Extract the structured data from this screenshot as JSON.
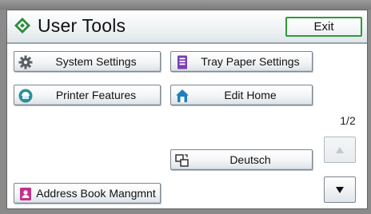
{
  "window": {
    "title": "User Tools",
    "icon": "user-tools-diamond-icon",
    "exit_label": "Exit"
  },
  "buttons": {
    "system_settings": {
      "label": "System Settings",
      "icon": "gear-icon"
    },
    "tray_paper_settings": {
      "label": "Tray Paper Settings",
      "icon": "tray-paper-icon"
    },
    "printer_features": {
      "label": "Printer Features",
      "icon": "printer-features-icon"
    },
    "edit_home": {
      "label": "Edit Home",
      "icon": "home-icon"
    },
    "language": {
      "label": "Deutsch",
      "icon": "language-switch-icon"
    },
    "address_book": {
      "label": "Address Book Mangmnt",
      "icon": "address-book-icon"
    }
  },
  "pagination": {
    "indicator": "1/2",
    "up_icon": "triangle-up-icon",
    "down_icon": "triangle-down-icon"
  },
  "colors": {
    "accent_green": "#2f9a3a",
    "panel_bg": "#ffffff",
    "frame_bg": "#8a8a8a"
  }
}
